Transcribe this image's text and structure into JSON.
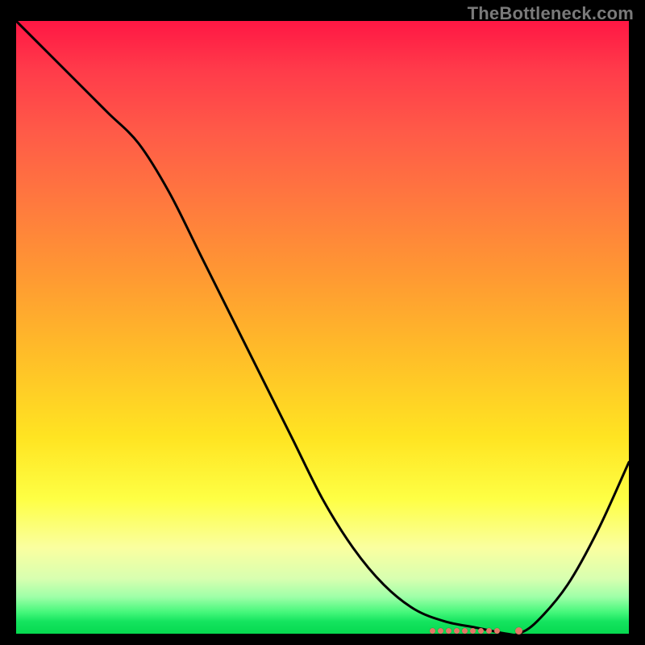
{
  "watermark": "TheBottleneck.com",
  "chart_data": {
    "type": "line",
    "title": "",
    "xlabel": "",
    "ylabel": "",
    "xlim": [
      0,
      100
    ],
    "ylim": [
      0,
      100
    ],
    "grid": false,
    "series": [
      {
        "name": "curve",
        "x": [
          0,
          5,
          10,
          15,
          20,
          25,
          30,
          35,
          40,
          45,
          50,
          55,
          60,
          65,
          70,
          75,
          80,
          82,
          85,
          90,
          95,
          100
        ],
        "values": [
          100,
          95,
          90,
          85,
          80,
          72,
          62,
          52,
          42,
          32,
          22,
          14,
          8,
          4,
          2,
          1,
          0,
          0,
          2,
          8,
          17,
          28
        ]
      }
    ],
    "markers": {
      "cluster": {
        "y": 0.5,
        "x_start": 68,
        "x_end": 78.5,
        "count": 9
      },
      "outlier": {
        "x": 82,
        "y": 0.5
      }
    },
    "colors": {
      "curve": "#000000",
      "markers": "#e47766",
      "gradient_top": "#ff1744",
      "gradient_bottom": "#06d94f"
    }
  }
}
